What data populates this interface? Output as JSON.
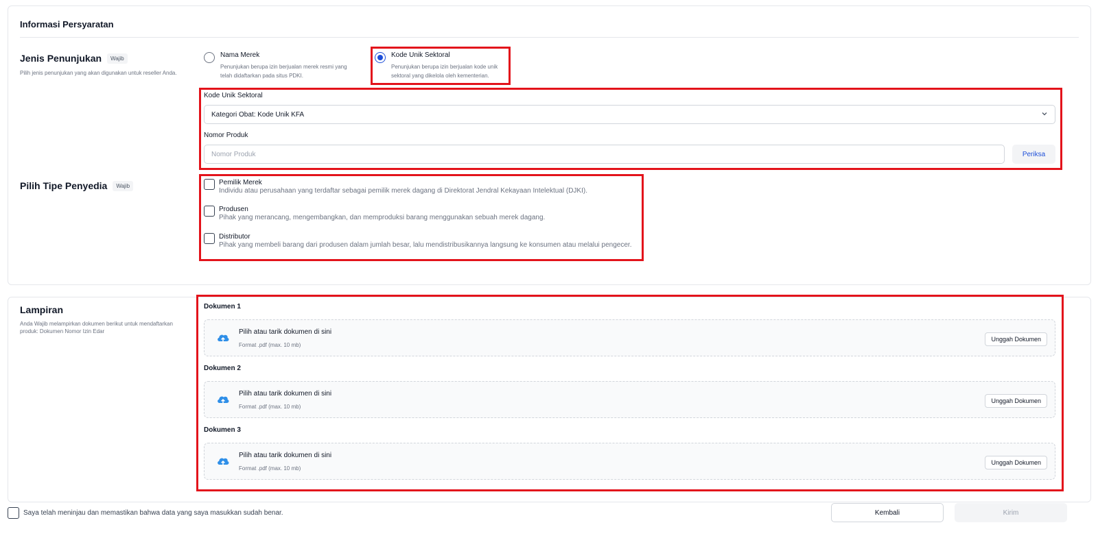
{
  "section": {
    "title": "Informasi Persyaratan"
  },
  "jenis": {
    "label": "Jenis Penunjukan",
    "badge": "Wajib",
    "desc": "Pilih jenis penunjukan yang akan digunakan untuk reseller Anda.",
    "options": [
      {
        "title": "Nama Merek",
        "desc": "Penunjukan berupa izin berjualan merek resmi yang telah didaftarkan pada situs PDKI.",
        "selected": false
      },
      {
        "title": "Kode Unik Sektoral",
        "desc": "Penunjukan berupa izin berjualan kode unik sektoral yang dikelola oleh kementerian.",
        "selected": true
      }
    ]
  },
  "kode": {
    "label": "Kode Unik Sektoral",
    "value": "Kategori Obat: Kode Unik KFA",
    "nomor_label": "Nomor Produk",
    "nomor_placeholder": "Nomor Produk",
    "check_label": "Periksa"
  },
  "tipe": {
    "label": "Pilih Tipe Penyedia",
    "badge": "Wajib",
    "options": [
      {
        "title": "Pemilik Merek",
        "desc": "Individu atau perusahaan yang terdaftar sebagai pemilik merek dagang di Direktorat Jendral Kekayaan Intelektual (DJKI).",
        "checked": false
      },
      {
        "title": "Produsen",
        "desc": "Pihak yang merancang, mengembangkan, dan memproduksi barang menggunakan sebuah merek dagang.",
        "checked": false
      },
      {
        "title": "Distributor",
        "desc": "Pihak yang membeli barang dari produsen dalam jumlah besar, lalu mendistribusikannya langsung ke konsumen atau melalui pengecer.",
        "checked": false
      }
    ]
  },
  "lampiran": {
    "label": "Lampiran",
    "desc": "Anda Wajib melampirkan dokumen berikut untuk mendaftarkan produk: Dokumen Nomor Izin Edar",
    "docs": [
      {
        "label": "Dokumen 1",
        "drop_title": "Pilih atau tarik dokumen di sini",
        "drop_sub": "Format .pdf (max. 10 mb)",
        "button": "Unggah Dokumen"
      },
      {
        "label": "Dokumen 2",
        "drop_title": "Pilih atau tarik dokumen di sini",
        "drop_sub": "Format .pdf (max. 10 mb)",
        "button": "Unggah Dokumen"
      },
      {
        "label": "Dokumen 3",
        "drop_title": "Pilih atau tarik dokumen di sini",
        "drop_sub": "Format .pdf (max. 10 mb)",
        "button": "Unggah Dokumen"
      }
    ]
  },
  "footer": {
    "confirm_text": "Saya telah meninjau dan memastikan bahwa data yang saya masukkan sudah benar.",
    "back_label": "Kembali",
    "send_label": "Kirim"
  },
  "colors": {
    "accent": "#1e4fd8",
    "highlight": "#e3131b",
    "upload_icon": "#2f8fe8"
  },
  "icons": {
    "select_chevron": "chevron-down-icon",
    "upload": "cloud-upload-icon"
  }
}
